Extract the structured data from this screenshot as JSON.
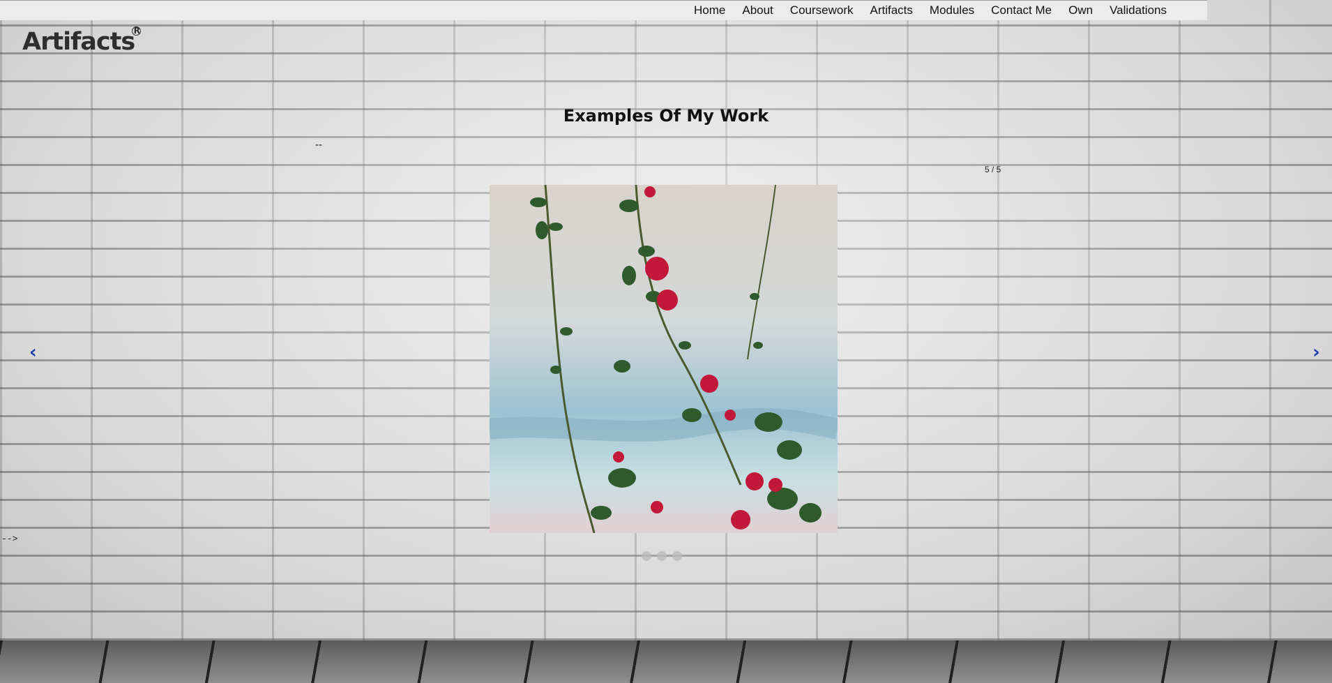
{
  "nav": {
    "items": [
      {
        "label": "Home"
      },
      {
        "label": "About"
      },
      {
        "label": "Coursework"
      },
      {
        "label": "Artifacts"
      },
      {
        "label": "Modules"
      },
      {
        "label": "Contact Me"
      },
      {
        "label": "Own"
      },
      {
        "label": "Validations"
      }
    ]
  },
  "logo": {
    "text": "Artifacts",
    "mark": "R"
  },
  "gallery": {
    "title": "Examples Of My Work",
    "dash": "--",
    "counter": "5 / 5",
    "prev_icon": "‹",
    "next_icon": "›",
    "comment_end": "-->",
    "dot_count": 3,
    "active_dot": 3
  },
  "colors": {
    "nav_bg": "#ececec",
    "arrow": "#1a3fa6",
    "rose": "#c2183a",
    "leaf": "#2f5a2e"
  }
}
